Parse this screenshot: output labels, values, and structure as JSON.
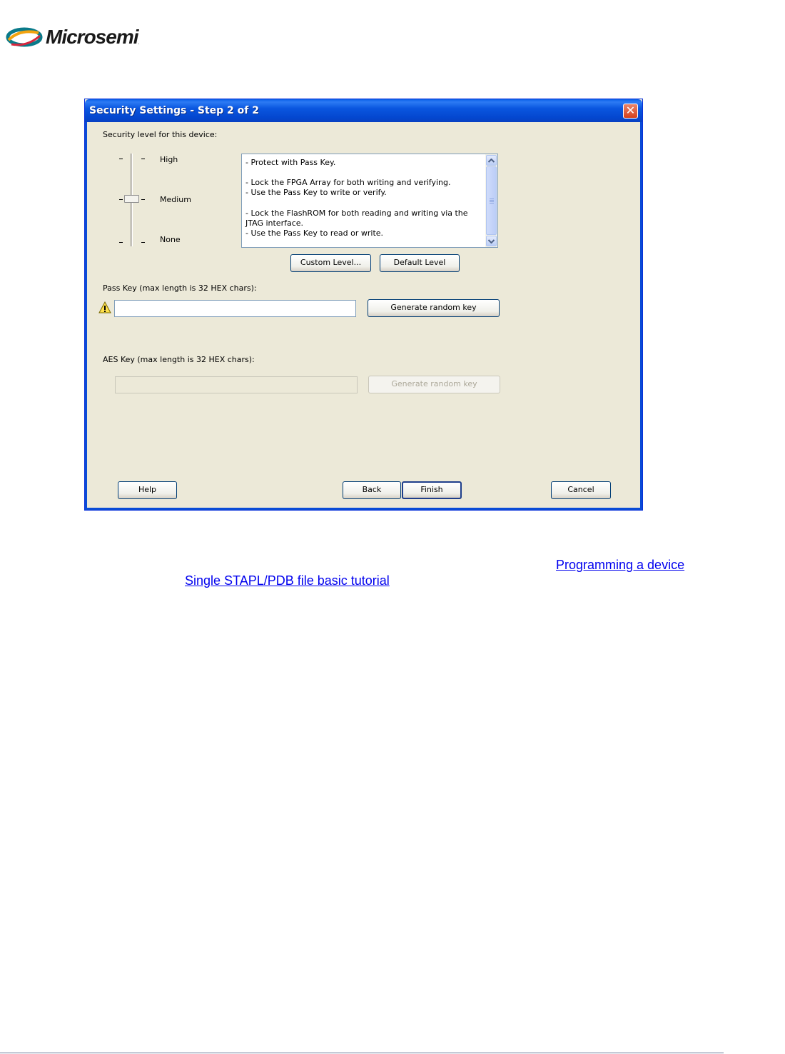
{
  "logo": {
    "text": "Microsemi",
    "tm": "."
  },
  "dialog": {
    "title": "Security Settings - Step 2 of 2",
    "close_glyph": "✕",
    "security_level_label": "Security level for this device:",
    "slider": {
      "levels": [
        "High",
        "Medium",
        "None"
      ],
      "selected": "Medium",
      "tick_glyph": "-"
    },
    "description_lines": [
      "- Protect with Pass Key.",
      "",
      "- Lock the FPGA Array for both writing and verifying.",
      "- Use the Pass Key to write or verify.",
      "",
      "- Lock the FlashROM for both reading and writing via the",
      "JTAG interface.",
      "- Use the Pass Key to read or write."
    ],
    "custom_level_label": "Custom Level...",
    "default_level_label": "Default Level",
    "pass_key": {
      "label": "Pass Key (max length is 32 HEX chars):",
      "value": "",
      "generate_label": "Generate random key"
    },
    "aes_key": {
      "label": "AES Key (max length is 32 HEX chars):",
      "value": "",
      "generate_label": "Generate random key"
    },
    "help_label": "Help",
    "back_label": "Back",
    "finish_label": "Finish",
    "cancel_label": "Cancel"
  },
  "links": {
    "programming_device": "Programming a device",
    "stapl_tutorial": "Single STAPL/PDB file basic tutorial"
  },
  "icons": {
    "logo": "microsemi-logo-icon",
    "warning": "warning-icon",
    "close": "close-icon",
    "scroll_up": "scroll-up-arrow-icon",
    "scroll_down": "scroll-down-arrow-icon"
  },
  "colors": {
    "titlebar": "#0A56DF",
    "dialog_bg": "#ECE9D8",
    "close_button": "#D5401C",
    "link": "#0000EE"
  }
}
